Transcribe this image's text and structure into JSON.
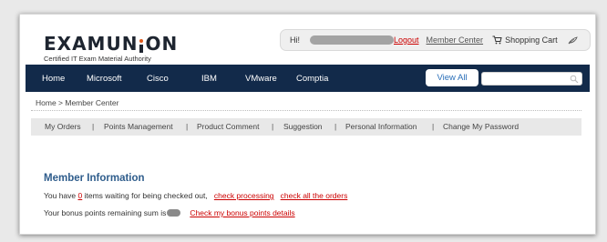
{
  "header": {
    "logo": {
      "part1": "EXAMUN",
      "part2": "ON"
    },
    "tagline": "Certified IT Exam Material Authority"
  },
  "userbar": {
    "greeting": "Hi!",
    "logout": "Logout",
    "member_center": "Member Center",
    "shopping_cart": "Shopping Cart"
  },
  "nav": {
    "items": [
      "Home",
      "Microsoft",
      "Cisco",
      "IBM",
      "VMware",
      "Comptia"
    ],
    "view_all": "View All",
    "search_placeholder": ""
  },
  "breadcrumb": "Home > Member Center",
  "subnav": {
    "items": [
      "My Orders",
      "Points Management",
      "Product Comment",
      "Suggestion",
      "Personal Information",
      "Change My Password"
    ],
    "separator": "|"
  },
  "member_info": {
    "title": "Member Information",
    "line1_prefix": "You have",
    "pending_count": "0",
    "line1_suffix": "items waiting for being checked out,",
    "check_processing": "check processing",
    "check_all_orders": "check all the orders",
    "line2_prefix": "Your bonus points remaining sum is",
    "bonus_link": "Check my bonus points details"
  },
  "colors": {
    "nav_bg": "#122a4a",
    "title_blue": "#2f5d8c",
    "link_red": "#cc0000",
    "logo_accent": "#e05a1b"
  }
}
